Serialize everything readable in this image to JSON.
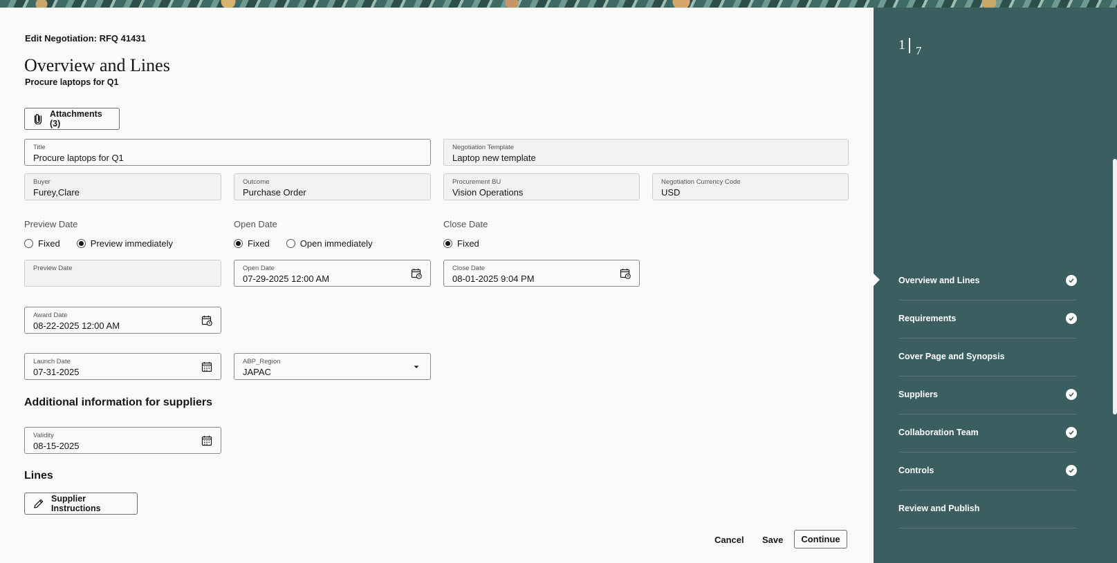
{
  "header": {
    "breadcrumb": "Edit Negotiation: RFQ 41431",
    "title": "Overview and Lines",
    "subtitle": "Procure laptops for Q1"
  },
  "attachments_button": "Attachments (3)",
  "fields": {
    "title": {
      "label": "Title",
      "value": "Procure laptops for Q1"
    },
    "template": {
      "label": "Negotiation Template",
      "value": "Laptop new template"
    },
    "buyer": {
      "label": "Buyer",
      "value": "Furey,Clare"
    },
    "outcome": {
      "label": "Outcome",
      "value": "Purchase Order"
    },
    "procurement_bu": {
      "label": "Procurement BU",
      "value": "Vision Operations"
    },
    "currency": {
      "label": "Negotiation Currency Code",
      "value": "USD"
    },
    "preview_date": {
      "label": "Preview Date",
      "value": ""
    },
    "open_date": {
      "label": "Open Date",
      "value": "07-29-2025 12:00 AM"
    },
    "close_date": {
      "label": "Close Date",
      "value": "08-01-2025 9:04 PM"
    },
    "award_date": {
      "label": "Award Date",
      "value": "08-22-2025 12:00 AM"
    },
    "launch_date": {
      "label": "Launch Date",
      "value": "07-31-2025"
    },
    "region": {
      "label": "ABP_Region",
      "value": "JAPAC"
    },
    "validity": {
      "label": "Validity",
      "value": "08-15-2025"
    }
  },
  "groups": {
    "preview": {
      "label": "Preview Date",
      "opt1": "Fixed",
      "opt2": "Preview immediately",
      "selected": "Preview immediately"
    },
    "open": {
      "label": "Open Date",
      "opt1": "Fixed",
      "opt2": "Open immediately",
      "selected": "Fixed"
    },
    "close": {
      "label": "Close Date",
      "opt1": "Fixed",
      "selected": "Fixed"
    }
  },
  "sections": {
    "additional": "Additional information for suppliers",
    "lines": "Lines"
  },
  "supplier_instructions_button": "Supplier Instructions",
  "footer": {
    "cancel": "Cancel",
    "save": "Save",
    "continue": "Continue"
  },
  "progress": {
    "current": "1",
    "total": "7"
  },
  "steps": [
    {
      "label": "Overview and Lines",
      "complete": true
    },
    {
      "label": "Requirements",
      "complete": true
    },
    {
      "label": "Cover Page and Synopsis",
      "complete": false
    },
    {
      "label": "Suppliers",
      "complete": true
    },
    {
      "label": "Collaboration Team",
      "complete": true
    },
    {
      "label": "Controls",
      "complete": true
    },
    {
      "label": "Review and Publish",
      "complete": false
    }
  ],
  "colors": {
    "rail": "#3b5f60",
    "page": "#fafaf9",
    "text": "#161513"
  }
}
